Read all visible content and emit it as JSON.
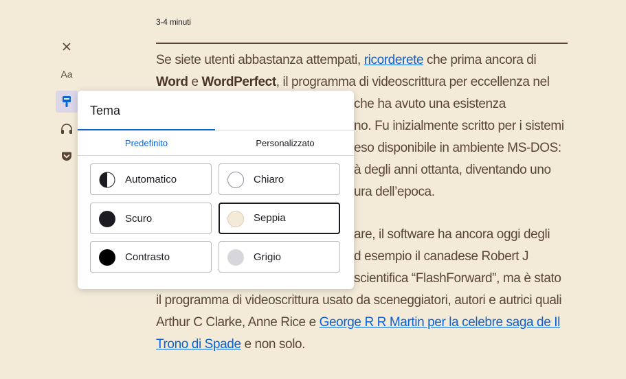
{
  "reading_time": "3-4 minuti",
  "sidebar": {
    "close_icon": "close-icon",
    "font_label": "Aa",
    "theme_icon": "paintbrush-icon",
    "listen_icon": "headphones-icon",
    "pocket_icon": "pocket-icon"
  },
  "article": {
    "p1": {
      "t1": "Se siete utenti abbastanza attempati, ",
      "link1": "ricorderete",
      "t2": " che prima ancora di ",
      "b1": "Word",
      "t3": " e ",
      "b2": "WordPerfect",
      "t4": ", il programma di videoscrittura per eccellenza nel",
      "line3": "che ha avuto una esistenza",
      "line4": "no. Fu inizialmente scritto per i sistemi",
      "line5": "eso disponibile in ambiente MS-DOS:",
      "line6": "à degli anni ottanta, diventando uno",
      "line7": "ura dell’epoca."
    },
    "p2": {
      "line1": "are, il software ha ancora oggi degli",
      "line2": "d esempio il canadese Robert J",
      "line3": "scientifica “FlashForward”, ma è stato",
      "line4": "il programma di videoscrittura usato da sceneggiatori, autori e autrici quali",
      "line5a": "Arthur C Clarke, Anne Rice e ",
      "link_a": "George R R Martin per la celebre saga de Il",
      "link_b": "Trono di Spade",
      "line6b": " e non solo."
    }
  },
  "theme_popup": {
    "title": "Tema",
    "tabs": [
      "Predefinito",
      "Personalizzato"
    ],
    "active_tab": "Predefinito",
    "themes": [
      {
        "label": "Automatico",
        "swatch": "half"
      },
      {
        "label": "Chiaro",
        "swatch": "#ffffff"
      },
      {
        "label": "Scuro",
        "swatch": "#1c1b22"
      },
      {
        "label": "Seppia",
        "swatch": "#f3ead8"
      },
      {
        "label": "Contrasto",
        "swatch": "#000000"
      },
      {
        "label": "Grigio",
        "swatch": "#d7d7db"
      }
    ],
    "selected_theme": "Seppia"
  },
  "colors": {
    "background": "#f3ead8",
    "text": "#5b4636",
    "link": "#0a62d9",
    "accent": "#0a62d9"
  }
}
